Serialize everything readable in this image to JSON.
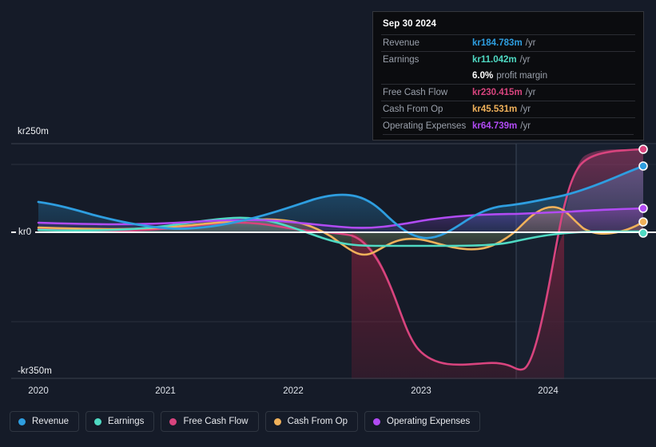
{
  "chart_data": {
    "type": "area",
    "title": "",
    "xlabel": "",
    "ylabel": "",
    "currency_prefix": "kr",
    "ylim": [
      -350,
      250
    ],
    "y_ticks": [
      "kr250m",
      "kr0",
      "-kr350m"
    ],
    "x_ticks": [
      "2020",
      "2021",
      "2022",
      "2023",
      "2024"
    ],
    "grid": true,
    "legend_position": "bottom-left",
    "forecast_divider_x": "2023.75",
    "series": [
      {
        "name": "Revenue",
        "color": "#2e9ee0",
        "values": [
          95,
          88,
          82,
          80,
          82,
          86,
          92,
          98,
          104,
          106,
          100,
          84,
          62,
          44,
          40,
          52,
          74,
          96,
          110,
          118,
          120,
          124,
          132,
          142,
          152,
          166,
          178,
          184.783
        ]
      },
      {
        "name": "Earnings",
        "color": "#4fdac3",
        "values": [
          4,
          3,
          2,
          2,
          3,
          5,
          8,
          14,
          20,
          26,
          24,
          14,
          2,
          -6,
          -12,
          -16,
          -18,
          -18,
          -16,
          -14,
          -12,
          -6,
          0,
          4,
          6,
          8,
          10,
          11.042
        ]
      },
      {
        "name": "Free Cash Flow",
        "color": "#d8447e",
        "values": [
          6,
          5,
          4,
          4,
          5,
          8,
          10,
          12,
          14,
          16,
          14,
          6,
          -10,
          -40,
          -120,
          -230,
          -290,
          -300,
          -296,
          -292,
          -300,
          -306,
          -180,
          10,
          130,
          160,
          172,
          230.415
        ]
      },
      {
        "name": "Cash From Op",
        "color": "#f0b15a",
        "values": [
          10,
          9,
          7,
          6,
          8,
          10,
          14,
          20,
          26,
          30,
          26,
          16,
          2,
          -20,
          -58,
          -70,
          -44,
          -28,
          -24,
          -26,
          -30,
          -20,
          28,
          62,
          30,
          14,
          26,
          45.531
        ]
      },
      {
        "name": "Operating Expenses",
        "color": "#b14bf4",
        "values": [
          22,
          21,
          20,
          20,
          20,
          21,
          22,
          23,
          24,
          25,
          24,
          22,
          20,
          18,
          18,
          20,
          24,
          28,
          32,
          34,
          35,
          36,
          38,
          42,
          46,
          52,
          58,
          64.739
        ]
      }
    ]
  },
  "tooltip": {
    "date": "Sep 30 2024",
    "rows": [
      {
        "name": "Revenue",
        "value": "kr184.783m",
        "unit": "/yr",
        "color": "#2e9ee0"
      },
      {
        "name": "Earnings",
        "value": "kr11.042m",
        "unit": "/yr",
        "color": "#4fdac3"
      },
      {
        "name": "Free Cash Flow",
        "value": "kr230.415m",
        "unit": "/yr",
        "color": "#d8447e"
      },
      {
        "name": "Cash From Op",
        "value": "kr45.531m",
        "unit": "/yr",
        "color": "#f0b15a"
      },
      {
        "name": "Operating Expenses",
        "value": "kr64.739m",
        "unit": "/yr",
        "color": "#b14bf4"
      }
    ],
    "profit_margin_value": "6.0%",
    "profit_margin_label": "profit margin"
  },
  "axis": {
    "y_top": "kr250m",
    "y_zero": "kr0",
    "y_bottom": "-kr350m",
    "x": [
      "2020",
      "2021",
      "2022",
      "2023",
      "2024"
    ]
  },
  "legend": {
    "items": [
      {
        "label": "Revenue",
        "color": "#2e9ee0"
      },
      {
        "label": "Earnings",
        "color": "#4fdac3"
      },
      {
        "label": "Free Cash Flow",
        "color": "#d8447e"
      },
      {
        "label": "Cash From Op",
        "color": "#f0b15a"
      },
      {
        "label": "Operating Expenses",
        "color": "#b14bf4"
      }
    ]
  }
}
